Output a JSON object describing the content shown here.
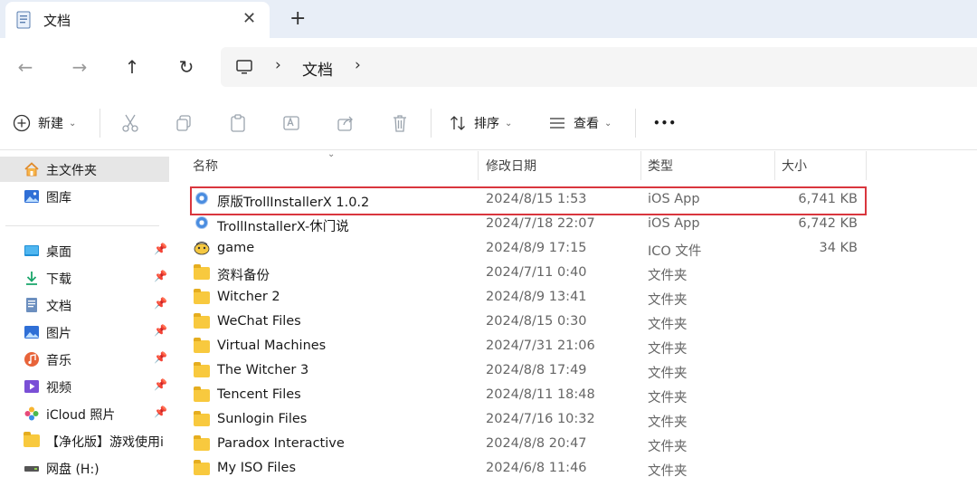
{
  "tab": {
    "title": "文档",
    "close": "✕",
    "add": "+"
  },
  "nav": {
    "back": "←",
    "forward": "→",
    "up": "↑",
    "refresh": "↻",
    "breadcrumb_sep1": "›",
    "breadcrumb_folder": "文档",
    "breadcrumb_sep2": "›"
  },
  "toolbar": {
    "new_label": "新建",
    "sort_label": "排序",
    "view_label": "查看",
    "more": "•••",
    "caret": "⌄"
  },
  "sidebar": {
    "items": [
      {
        "label": "主文件夹",
        "icon": "home-icon",
        "pinned": false
      },
      {
        "label": "图库",
        "icon": "gallery-icon",
        "pinned": false
      },
      {
        "label": "桌面",
        "icon": "desktop-icon",
        "pinned": true
      },
      {
        "label": "下载",
        "icon": "download-icon",
        "pinned": true
      },
      {
        "label": "文档",
        "icon": "document-icon",
        "pinned": true
      },
      {
        "label": "图片",
        "icon": "pictures-icon",
        "pinned": true
      },
      {
        "label": "音乐",
        "icon": "music-icon",
        "pinned": true
      },
      {
        "label": "视频",
        "icon": "video-icon",
        "pinned": true
      },
      {
        "label": "iCloud 照片",
        "icon": "icloud-photos-icon",
        "pinned": true
      },
      {
        "label": "【净化版】游戏使用i",
        "icon": "folder-icon",
        "pinned": false
      },
      {
        "label": "网盘 (H:)",
        "icon": "drive-icon",
        "pinned": false
      }
    ]
  },
  "columns": {
    "name": "名称",
    "date": "修改日期",
    "type": "类型",
    "size": "大小"
  },
  "files": [
    {
      "name": "原版TrollInstallerX 1.0.2",
      "date": "2024/8/15 1:53",
      "type": "iOS App",
      "size": "6,741 KB",
      "icon": "app-icon"
    },
    {
      "name": "TrollInstallerX-休门说",
      "date": "2024/7/18 22:07",
      "type": "iOS App",
      "size": "6,742 KB",
      "icon": "app-icon"
    },
    {
      "name": "game",
      "date": "2024/8/9 17:15",
      "type": "ICO 文件",
      "size": "34 KB",
      "icon": "ico-file-icon"
    },
    {
      "name": "资料备份",
      "date": "2024/7/11 0:40",
      "type": "文件夹",
      "size": "",
      "icon": "folder-icon"
    },
    {
      "name": "Witcher 2",
      "date": "2024/8/9 13:41",
      "type": "文件夹",
      "size": "",
      "icon": "folder-icon"
    },
    {
      "name": "WeChat Files",
      "date": "2024/8/15 0:30",
      "type": "文件夹",
      "size": "",
      "icon": "folder-icon"
    },
    {
      "name": "Virtual Machines",
      "date": "2024/7/31 21:06",
      "type": "文件夹",
      "size": "",
      "icon": "folder-icon"
    },
    {
      "name": "The Witcher 3",
      "date": "2024/8/8 17:49",
      "type": "文件夹",
      "size": "",
      "icon": "folder-icon"
    },
    {
      "name": "Tencent Files",
      "date": "2024/8/11 18:48",
      "type": "文件夹",
      "size": "",
      "icon": "folder-icon"
    },
    {
      "name": "Sunlogin Files",
      "date": "2024/7/16 10:32",
      "type": "文件夹",
      "size": "",
      "icon": "folder-icon"
    },
    {
      "name": "Paradox Interactive",
      "date": "2024/8/8 20:47",
      "type": "文件夹",
      "size": "",
      "icon": "folder-icon"
    },
    {
      "name": "My ISO Files",
      "date": "2024/6/8 11:46",
      "type": "文件夹",
      "size": "",
      "icon": "folder-icon"
    }
  ],
  "colors": {
    "highlight": "#d9363e",
    "tabbar": "#e8eef7",
    "selected": "#e6e6e6",
    "folder": "#f8c93e"
  }
}
